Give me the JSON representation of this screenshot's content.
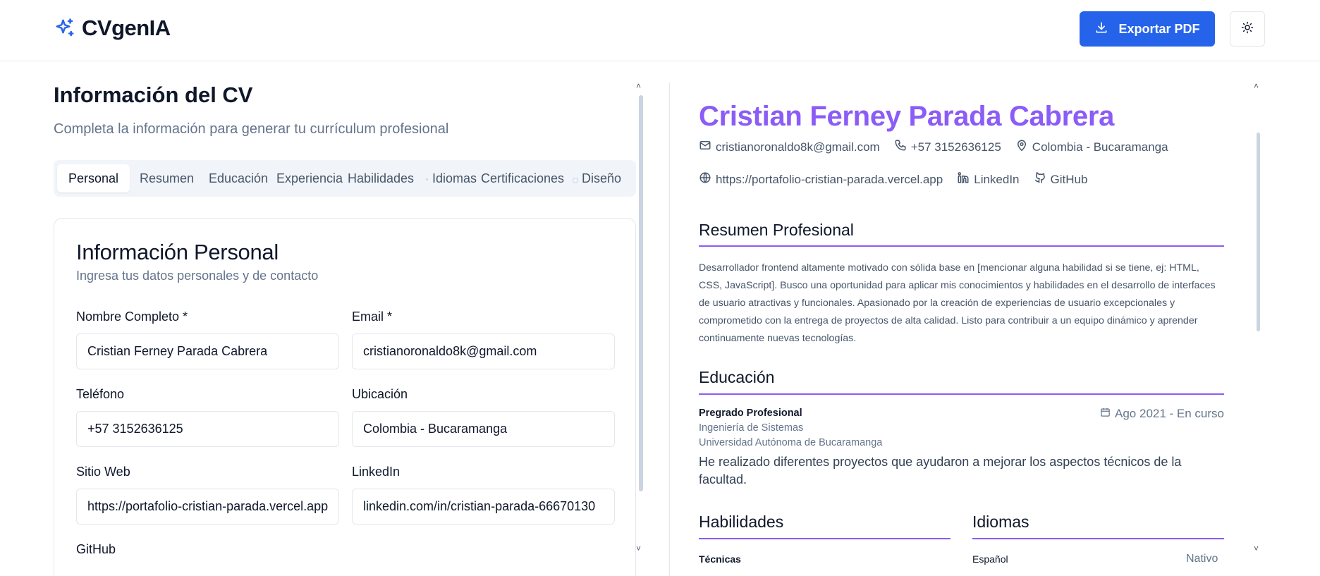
{
  "header": {
    "brand": "CVgenIA",
    "export_label": "Exportar PDF"
  },
  "editor": {
    "title": "Información del CV",
    "subtitle": "Completa la información para generar tu currículum profesional",
    "tabs": [
      "Personal",
      "Resumen",
      "Educación",
      "Experiencia",
      "Habilidades",
      "Idiomas",
      "Certificaciones",
      "Diseño"
    ],
    "active_tab": "Personal",
    "personal": {
      "title": "Información Personal",
      "subtitle": "Ingresa tus datos personales y de contacto",
      "fields": {
        "name": {
          "label": "Nombre Completo *",
          "value": "Cristian Ferney Parada Cabrera"
        },
        "email": {
          "label": "Email *",
          "value": "cristianoronaldo8k@gmail.com"
        },
        "phone": {
          "label": "Teléfono",
          "value": "+57 3152636125"
        },
        "location": {
          "label": "Ubicación",
          "value": "Colombia - Bucaramanga"
        },
        "website": {
          "label": "Sitio Web",
          "value": "https://portafolio-cristian-parada.vercel.app"
        },
        "linkedin": {
          "label": "LinkedIn",
          "value": "linkedin.com/in/cristian-parada-66670130"
        },
        "github": {
          "label": "GitHub"
        }
      }
    }
  },
  "preview": {
    "name": "Cristian Ferney Parada Cabrera",
    "email": "cristianoronaldo8k@gmail.com",
    "phone": "+57 3152636125",
    "location": "Colombia - Bucaramanga",
    "website": "https://portafolio-cristian-parada.vercel.app",
    "linkedin": "LinkedIn",
    "github": "GitHub",
    "summary_title": "Resumen Profesional",
    "summary": "Desarrollador frontend altamente motivado con sólida base en [mencionar alguna habilidad si se tiene, ej: HTML, CSS, JavaScript]. Busco una oportunidad para aplicar mis conocimientos y habilidades en el desarrollo de interfaces de usuario atractivas y funcionales. Apasionado por la creación de experiencias de usuario excepcionales y comprometido con la entrega de proyectos de alta calidad. Listo para contribuir a un equipo dinámico y aprender continuamente nuevas tecnologías.",
    "education_title": "Educación",
    "education": {
      "degree": "Pregrado Profesional",
      "field": "Ingeniería de Sistemas",
      "institution": "Universidad Autónoma de Bucaramanga",
      "date": "Ago 2021 - En curso",
      "description": "He realizado diferentes proyectos que ayudaron a mejorar los aspectos técnicos de la facultad."
    },
    "skills_title": "Habilidades",
    "skills_sub": "Técnicas",
    "languages_title": "Idiomas",
    "language_name": "Español",
    "language_level": "Nativo"
  },
  "colors": {
    "accent": "#8b5cf6",
    "primary": "#2563eb"
  }
}
